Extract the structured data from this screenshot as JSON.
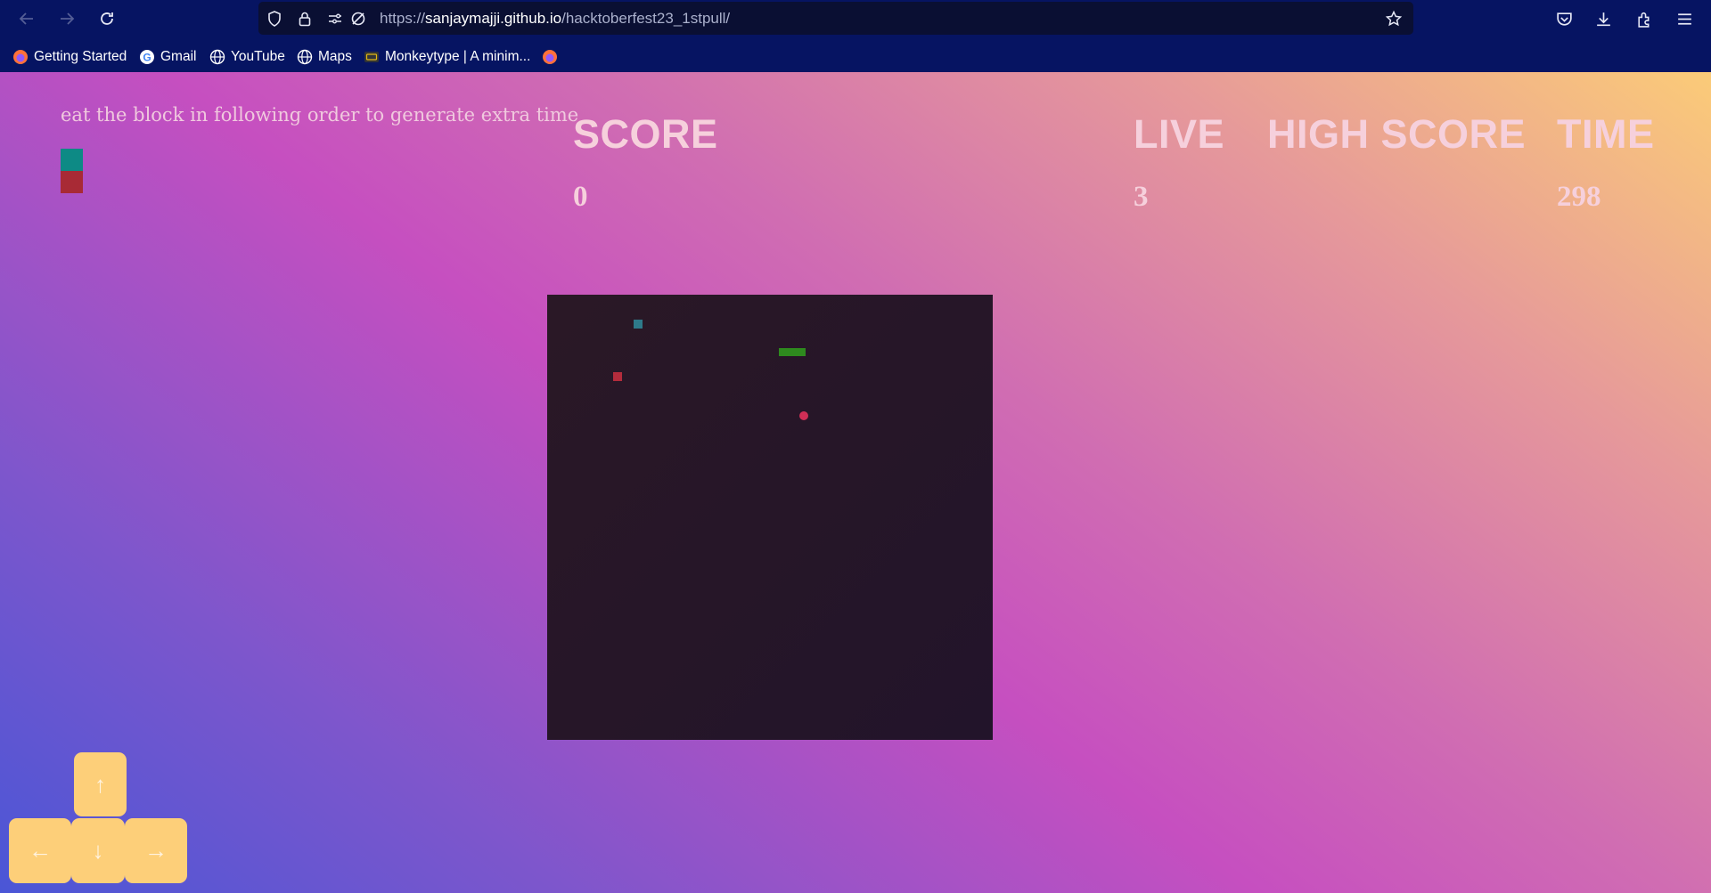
{
  "browser": {
    "url_scheme": "https://",
    "url_host": "sanjaymajji.github.io",
    "url_path": "/hacktoberfest23_1stpull/",
    "bookmarks": [
      {
        "label": "Getting Started",
        "icon": "firefox-icon"
      },
      {
        "label": "Gmail",
        "icon": "google-icon"
      },
      {
        "label": "YouTube",
        "icon": "globe-icon"
      },
      {
        "label": "Maps",
        "icon": "globe-icon"
      },
      {
        "label": "Monkeytype | A minim...",
        "icon": "keyboard-icon"
      },
      {
        "label": "",
        "icon": "firefox-icon"
      }
    ]
  },
  "game": {
    "hint": "eat the block in following order to generate extra time",
    "order_colors": [
      "#0d8a85",
      "#a82a35"
    ],
    "stats": {
      "score_label": "SCORE",
      "score_value": "0",
      "live_label": "LIVE",
      "live_value": "3",
      "high_score_label": "HIGH SCORE",
      "high_score_value": "",
      "time_label": "TIME",
      "time_value": "298"
    },
    "board_colors": {
      "snake": "#2e8a1e",
      "food": "#cf2e56",
      "teal_block": "#2e7a8a",
      "red_block": "#b32c3c"
    },
    "controls": {
      "up": "↑",
      "left": "←",
      "down": "↓",
      "right": "→"
    }
  }
}
